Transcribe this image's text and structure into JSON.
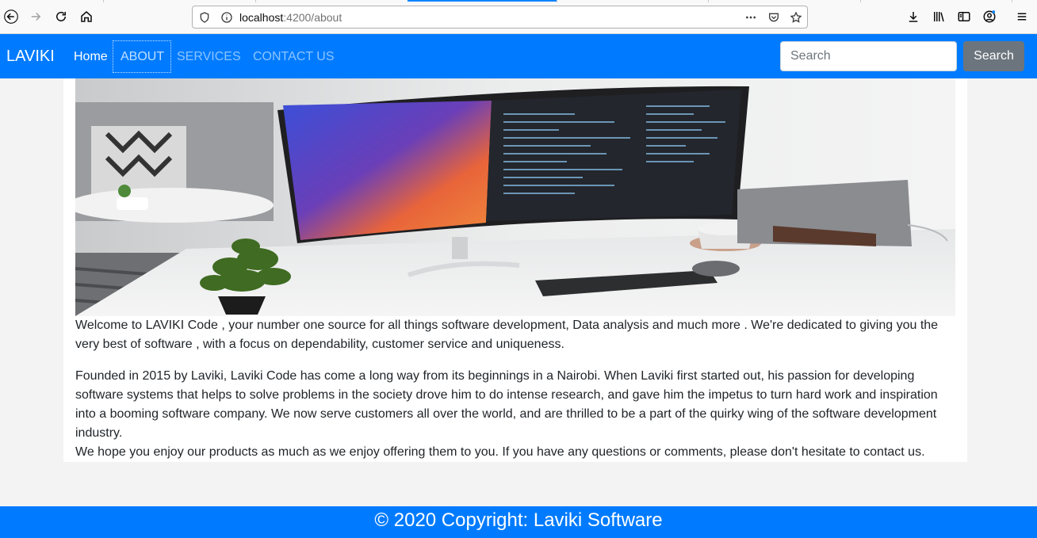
{
  "browser": {
    "url_host": "localhost",
    "url_path": ":4200/about",
    "icons": [
      "back-icon",
      "forward-icon",
      "reload-icon",
      "home-icon",
      "shield-icon",
      "info-icon",
      "more-icon",
      "pocket-icon",
      "star-icon",
      "download-icon",
      "library-icon",
      "sidebar-icon",
      "account-icon",
      "menu-icon"
    ]
  },
  "navbar": {
    "brand": "LAVIKI",
    "links": [
      "Home",
      "ABOUT",
      "SERVICES",
      "CONTACT US"
    ],
    "search_placeholder": "Search",
    "search_button": "Search",
    "color": "#007bff"
  },
  "main": {
    "paragraph1": "Welcome to LAVIKI Code , your number one source for all things software development, Data analysis and much more . We're dedicated to giving you the very best of software , with a focus on dependability, customer service and uniqueness.",
    "paragraph2": "Founded in 2015 by Laviki, Laviki Code has come a long way from its beginnings in a Nairobi. When Laviki first started out, his passion for developing software systems that helps to solve problems in the society drove him to do intense research, and gave him the impetus to turn hard work and inspiration into a booming software company. We now serve customers all over the world, and are thrilled to be a part of the quirky wing of the software development industry.",
    "paragraph3": "We hope you enjoy our products as much as we enjoy offering them to you. If you have any questions or comments, please don't hesitate to contact us."
  },
  "footer": {
    "text": "© 2020 Copyright: Laviki Software"
  }
}
